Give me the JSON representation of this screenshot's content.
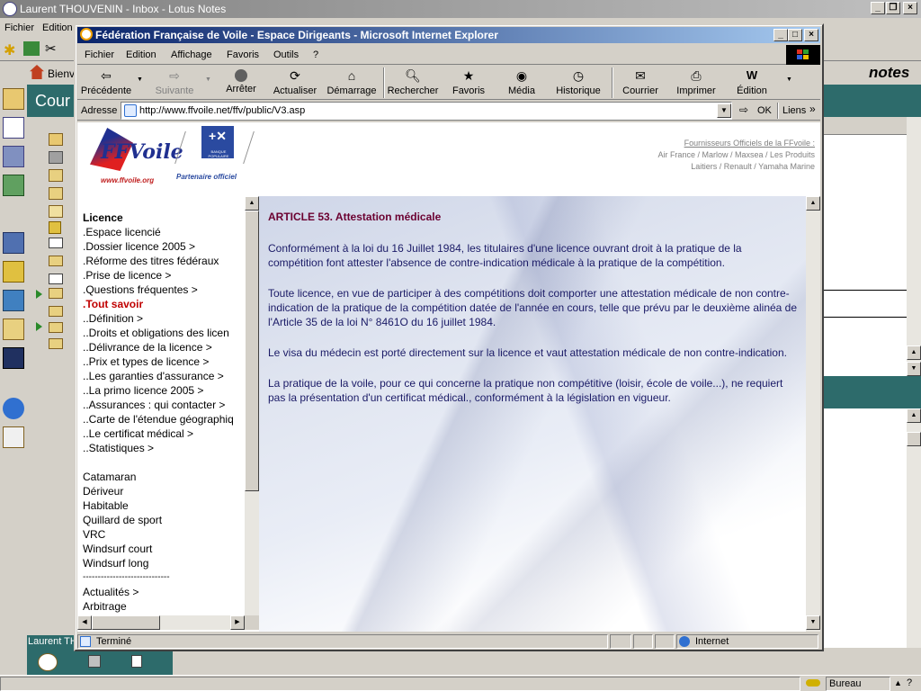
{
  "lotus": {
    "title": "Laurent THOUVENIN - Inbox - Lotus Notes",
    "menu": [
      "Fichier",
      "Edition"
    ],
    "home_label": "Bienv",
    "brand": "notes",
    "panel_title": "Cour",
    "status_user": "Laurent TH"
  },
  "ie": {
    "title": "Fédération Française de Voile - Espace Dirigeants - Microsoft Internet Explorer",
    "menu": [
      "Fichier",
      "Edition",
      "Affichage",
      "Favoris",
      "Outils",
      "?"
    ],
    "toolbar": {
      "back": "Précédente",
      "forward": "Suivante",
      "stop": "Arrêter",
      "refresh": "Actualiser",
      "home": "Démarrage",
      "search": "Rechercher",
      "favorites": "Favoris",
      "media": "Média",
      "history": "Historique",
      "mail": "Courrier",
      "print": "Imprimer",
      "edit": "Édition"
    },
    "address_label": "Adresse",
    "url": "http://www.ffvoile.net/ffv/public/V3.asp",
    "go_label": "OK",
    "links_label": "Liens",
    "status_text": "Terminé",
    "zone_text": "Internet"
  },
  "header": {
    "logo_text": "FFVoile",
    "logo_url": "www.ffvoile.org",
    "partner_bank": "BANQUE POPULAIRE",
    "partner_label": "Partenaire officiel",
    "suppliers_title": "Fournisseurs Officiels de la FFvoile :",
    "suppliers_line1": "Air France / Marlow / Maxsea / Les Produits",
    "suppliers_line2": "Laitiers / Renault / Yamaha Marine"
  },
  "sidebar": {
    "heading": "Licence",
    "items": [
      ".Espace licencié",
      ".Dossier licence 2005 >",
      ".Réforme des titres fédéraux",
      ".Prise de licence >",
      ".Questions fréquentes >",
      ".Tout savoir",
      "..Définition >",
      "..Droits et obligations des licen",
      "..Délivrance de la licence >",
      "..Prix et types de licence >",
      "..Les garanties d'assurance >",
      "..La primo licence 2005 >",
      "..Assurances : qui contacter >",
      "..Carte de l'étendue géographiq",
      "..Le certificat médical >",
      "..Statistiques >"
    ],
    "active_index": 5,
    "boats": [
      "Catamaran",
      "Dériveur",
      "Habitable",
      "Quillard de sport",
      "VRC",
      "Windsurf court",
      "Windsurf long"
    ],
    "separator": "-----------------------------",
    "bottom": [
      "Actualités >",
      "Arbitrage"
    ]
  },
  "article": {
    "title": "ARTICLE 53. Attestation médicale",
    "paragraphs": [
      "Conformément à la loi du 16 Juillet 1984, les titulaires d'une licence ouvrant droit à la pratique de la compétition font attester l'absence de contre-indication médicale à la pratique de la compétition.",
      "Toute licence, en vue de participer à des compétitions doit comporter une attestation médicale de non contre-indication de la pratique de la compétition datée de l'année en cours, telle que prévu par le deuxième alinéa de l'Article 35 de la loi N° 8461O du 16 juillet 1984.",
      "Le visa du médecin est porté directement sur la licence et vaut attestation médicale de non contre-indication.",
      "La pratique de la voile, pour ce qui concerne la pratique non compétitive (loisir, école de voile...), ne requiert pas la présentation d'un certificat médical., conformément à la législation en vigueur."
    ]
  },
  "taskbar": {
    "status_right": "Bureau"
  },
  "colors": {
    "title_start": "#0a246a",
    "title_end": "#a6caf0",
    "article_title": "#6b0030",
    "article_text": "#1a1a66",
    "active_link": "#c00000",
    "lotus_teal": "#2d6b6b"
  }
}
